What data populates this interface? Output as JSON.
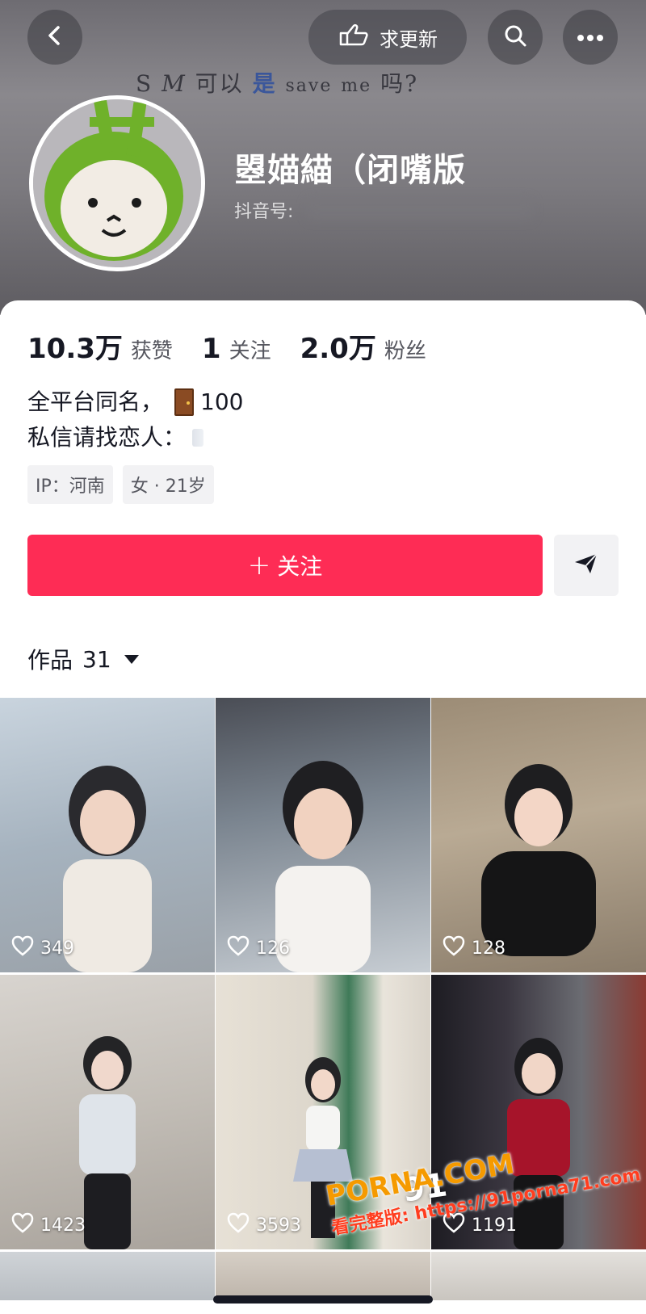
{
  "colors": {
    "accent": "#fe2c55",
    "text_primary": "#161823",
    "text_secondary": "#56575f",
    "tag_bg": "#f2f2f4"
  },
  "header": {
    "back_icon": "chevron-left-icon",
    "update_button": {
      "icon": "hand-pointing-icon",
      "label": "求更新"
    },
    "search_icon": "search-icon",
    "more_icon": "more-dots-icon",
    "cover_text_parts": [
      "S",
      "M",
      "可以",
      "是",
      "save",
      "me",
      "吗?"
    ]
  },
  "profile": {
    "display_name": "曌媌緢（闭嘴版",
    "douyin_id_label": "抖音号:",
    "stats": [
      {
        "value": "10.3万",
        "label": "获赞"
      },
      {
        "value": "1",
        "label": "关注"
      },
      {
        "value": "2.0万",
        "label": "粉丝"
      }
    ],
    "bio_line1": "全平台同名，",
    "bio_line1_suffix": "100",
    "bio_line2": "私信请找恋人：",
    "tags": [
      "IP：河南",
      "女 · 21岁"
    ]
  },
  "actions": {
    "follow_label": "关注",
    "follow_plus": "+",
    "share_icon": "send-arrow-icon"
  },
  "works": {
    "label": "作品",
    "count": "31",
    "videos": [
      {
        "likes": "349"
      },
      {
        "likes": "126"
      },
      {
        "likes": "128"
      },
      {
        "likes": "1423"
      },
      {
        "likes": "3593"
      },
      {
        "likes": "1191"
      }
    ]
  },
  "watermark": {
    "brand": "91",
    "site": "PORNA.COM",
    "text": "看完整版: https://91porna71.com"
  }
}
